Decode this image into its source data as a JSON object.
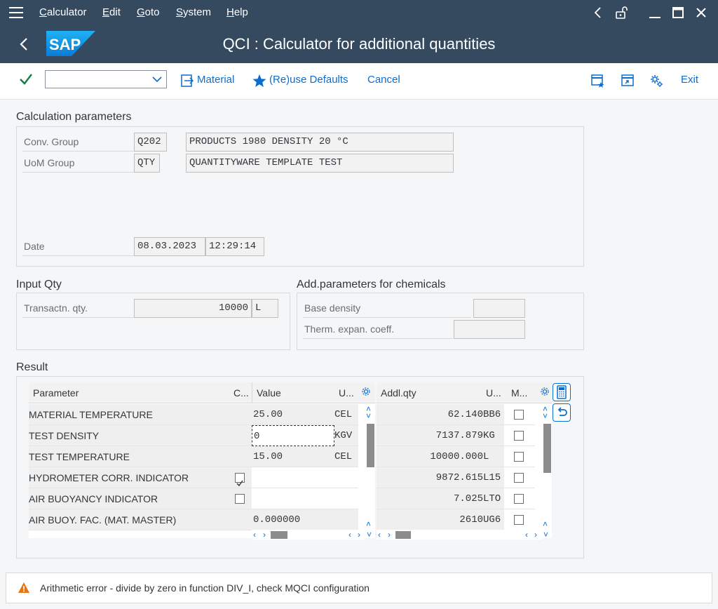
{
  "menu": {
    "items": [
      "Calculator",
      "Edit",
      "Goto",
      "System",
      "Help"
    ]
  },
  "title": {
    "logo_text": "SAP",
    "text": "QCI : Calculator for additional quantities"
  },
  "toolbar": {
    "ok_code_value": "",
    "material_label": "Material",
    "reuse_defaults_label": "(Re)use Defaults",
    "cancel_label": "Cancel",
    "exit_label": "Exit"
  },
  "calc_params": {
    "section_title": "Calculation parameters",
    "conv_group_label": "Conv. Group",
    "conv_group_value": "Q202",
    "conv_group_desc": "PRODUCTS 1980 DENSITY 20 °C",
    "uom_group_label": "UoM Group",
    "uom_group_value": "QTY",
    "uom_group_desc": "QUANTITYWARE TEMPLATE TEST",
    "date_label": "Date",
    "date_value": "08.03.2023",
    "time_value": "12:29:14"
  },
  "input_qty": {
    "section_title": "Input Qty",
    "transaction_label": "Transactn. qty.",
    "transaction_value": "10000",
    "transaction_unit": "L"
  },
  "chem_params": {
    "section_title": "Add.parameters for chemicals",
    "base_density_label": "Base density",
    "base_density_value": "",
    "therm_label": "Therm. expan. coeff.",
    "therm_value": ""
  },
  "result": {
    "section_title": "Result",
    "left_headers": {
      "parameter": "Parameter",
      "c": "C...",
      "value": "Value",
      "u": "U..."
    },
    "right_headers": {
      "addl_qty": "Addl.qty",
      "u": "U...",
      "m": "M..."
    },
    "params": [
      {
        "name": "MATERIAL TEMPERATURE",
        "checkbox": "",
        "value": "25.00",
        "unit": "CEL"
      },
      {
        "name": "TEST DENSITY",
        "checkbox": "",
        "value": "0",
        "unit": "KGV"
      },
      {
        "name": "TEST TEMPERATURE",
        "checkbox": "",
        "value": "15.00",
        "unit": "CEL"
      },
      {
        "name": "HYDROMETER CORR. INDICATOR",
        "checkbox": "checked",
        "value": "",
        "unit": ""
      },
      {
        "name": "AIR BUOYANCY INDICATOR",
        "checkbox": "unchecked",
        "value": "",
        "unit": ""
      },
      {
        "name": "AIR BUOY. FAC. (MAT. MASTER)",
        "checkbox": "",
        "value": "0.000000",
        "unit": ""
      }
    ],
    "quantities": [
      {
        "qty": "62.140",
        "unit": "BB6",
        "marked": false
      },
      {
        "qty": "7137.879",
        "unit": "KG",
        "marked": false
      },
      {
        "qty": "10000.000",
        "unit": "L",
        "marked": false
      },
      {
        "qty": "9872.615",
        "unit": "L15",
        "marked": false
      },
      {
        "qty": "7.025",
        "unit": "LTO",
        "marked": false
      },
      {
        "qty": "2610",
        "unit": "UG6",
        "marked": false
      }
    ]
  },
  "status": {
    "type": "warning",
    "message": "Arithmetic error - divide by zero in function DIV_I, check MQCI configuration"
  },
  "colors": {
    "shell": "#354a5f",
    "accent": "#0a6ed1",
    "check": "#107e3e",
    "warning": "#e9730c"
  }
}
